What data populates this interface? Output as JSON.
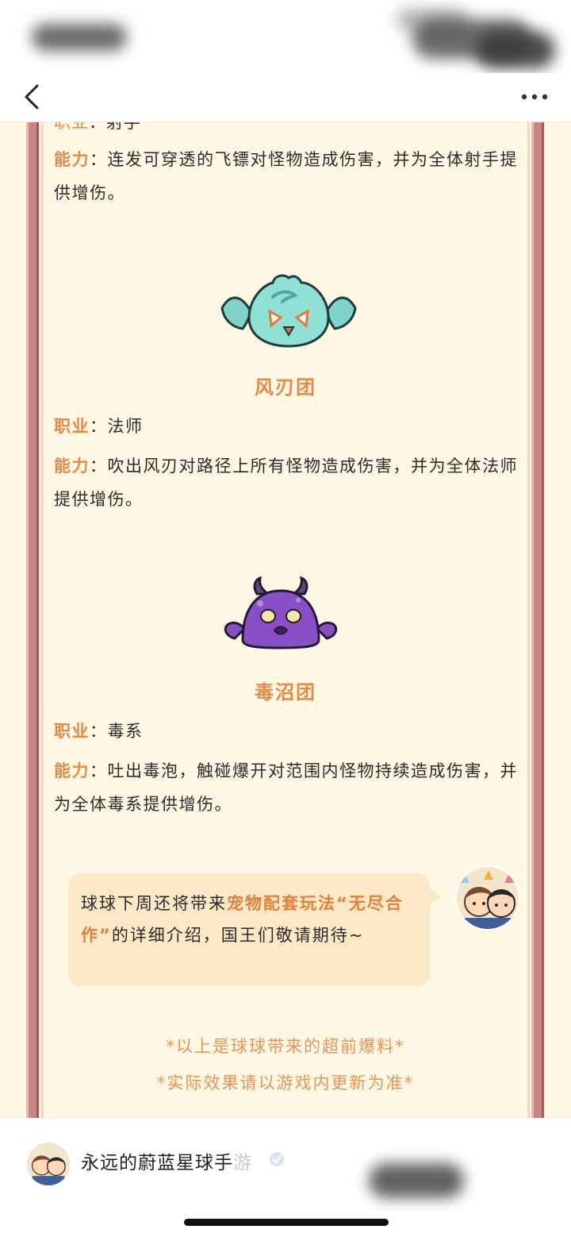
{
  "nav": {
    "back_icon": "chevron-left-icon",
    "more_icon": "more-dots-icon"
  },
  "article": {
    "cut_off_line": {
      "label": "职业",
      "colon": "：",
      "value": "射手"
    },
    "pet1": {
      "ability_label": "能力",
      "colon": "：",
      "ability_text": "连发可穿透的飞镖对怪物造成伤害，并为全体射手提供增伤。"
    },
    "pet2": {
      "name": "风刃团",
      "job_label": "职业",
      "colon": "：",
      "job_value": "法师",
      "ability_label": "能力",
      "ability_text": "吹出风刃对路径上所有怪物造成伤害，并为全体法师提供增伤。"
    },
    "pet3": {
      "name": "毒沼团",
      "job_label": "职业",
      "colon": "：",
      "job_value": "毒系",
      "ability_label": "能力",
      "ability_text": "吐出毒泡，触碰爆开对范围内怪物持续造成伤害，并为全体毒系提供增伤。"
    },
    "bubble": {
      "text_before": "球球下周还将带来",
      "highlight": "宠物配套玩法“无尽合作”",
      "text_after": "的详细介绍，国王们敬请期待~"
    },
    "footnotes": {
      "line1": "*以上是球球带来的超前爆料*",
      "line2": "*实际效果请以游戏内更新为准*"
    },
    "colors": {
      "accent_orange": "#e28b46",
      "page_bg": "#fdf7e3",
      "frame_pink": "#c98483",
      "bubble_bg": "#fbe8c6"
    }
  },
  "account": {
    "name_main": "永远的蔚蓝星球手",
    "name_faded": "游",
    "verified_icon": "verified-badge-icon"
  }
}
